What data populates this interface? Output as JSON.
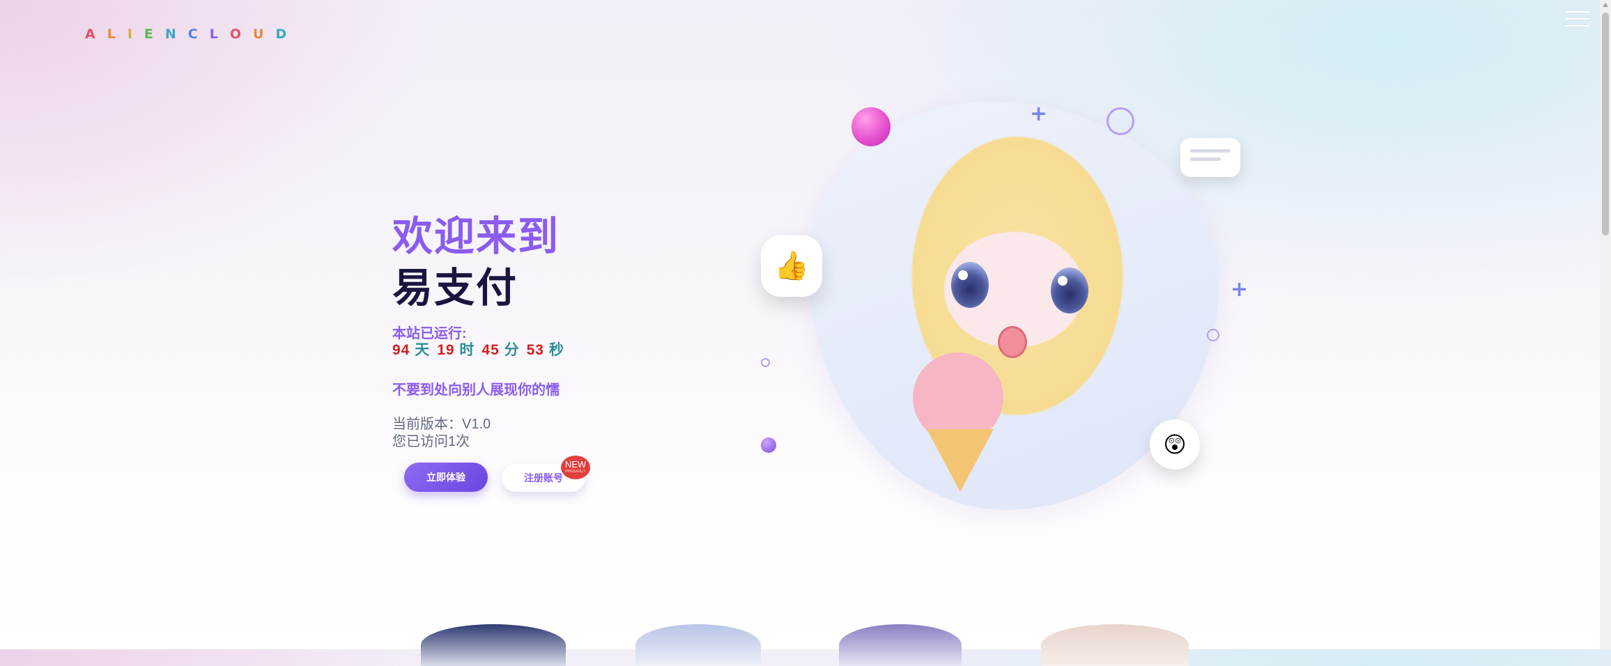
{
  "header": {
    "logo_letters": [
      {
        "ch": "A",
        "color": "#e0506a"
      },
      {
        "ch": "L",
        "color": "#e38a3a"
      },
      {
        "ch": "I",
        "color": "#d4b23a"
      },
      {
        "ch": "E",
        "color": "#5fb45a"
      },
      {
        "ch": "N",
        "color": "#3aa8c0"
      },
      {
        "ch": "C",
        "color": "#5b7de0"
      },
      {
        "ch": "L",
        "color": "#8a5cf0"
      },
      {
        "ch": "O",
        "color": "#e0506a"
      },
      {
        "ch": "U",
        "color": "#e38a3a"
      },
      {
        "ch": "D",
        "color": "#3aa8c0"
      }
    ],
    "menu_icon": "hamburger-icon"
  },
  "hero": {
    "title_line1": "欢迎来到",
    "title_line2": "易支付",
    "runtime_label": "本站已运行:",
    "runtime": {
      "days": "94",
      "days_unit": "天",
      "hours": "19",
      "hours_unit": "时",
      "minutes": "45",
      "minutes_unit": "分",
      "seconds": "53",
      "seconds_unit": "秒"
    },
    "motto": "不要到处向别人展现你的懦",
    "version": "当前版本：V1.0",
    "visits": "您已访问1次",
    "try_button": "立即体验",
    "register_button": "注册账号",
    "new_badge": "NEW",
    "new_badge_sub": "PRODUCT"
  },
  "illustration": {
    "thumbs_emoji": "👍",
    "surprised_emoji": "😲",
    "accent_colors": {
      "pink_ball": "#e34bcc",
      "ring": "#b89cf5",
      "plus": "#7b84f0"
    }
  },
  "colors": {
    "accent": "#8a5cf0",
    "title_dark": "#1a1540",
    "number_red": "#d12020",
    "unit_teal": "#2a8f98",
    "muted": "#666a80"
  }
}
